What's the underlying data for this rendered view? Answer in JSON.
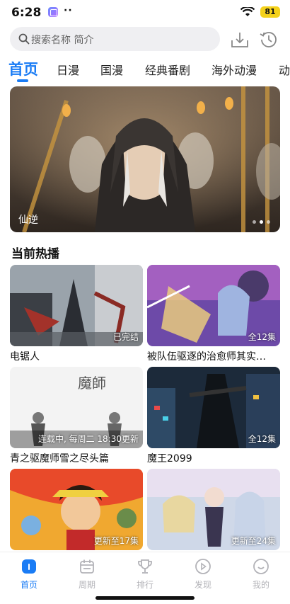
{
  "status": {
    "time": "6:28",
    "dots": "··",
    "battery": "81"
  },
  "search": {
    "placeholder": "搜索名称 简介"
  },
  "tabs": [
    "首页",
    "日漫",
    "国漫",
    "经典番剧",
    "海外动漫",
    "动"
  ],
  "banner": {
    "title": "仙逆"
  },
  "section": {
    "title": "当前热播"
  },
  "cards": [
    {
      "title": "电锯人",
      "badge": "已完结"
    },
    {
      "title": "被队伍驱逐的治愈师其实…",
      "badge": "全12集"
    },
    {
      "title": "青之驱魔师雪之尽头篇",
      "badge": "连载中, 每周二 18:30更新"
    },
    {
      "title": "魔王2099",
      "badge": "全12集"
    },
    {
      "title": "",
      "badge": "更新至17集"
    },
    {
      "title": "",
      "badge": "更新至24集"
    }
  ],
  "nav": [
    {
      "label": "首页",
      "icon": "home-icon"
    },
    {
      "label": "周期",
      "icon": "calendar-icon"
    },
    {
      "label": "排行",
      "icon": "trophy-icon"
    },
    {
      "label": "发现",
      "icon": "play-circle-icon"
    },
    {
      "label": "我的",
      "icon": "smile-icon"
    }
  ],
  "colors": {
    "accent": "#1a7cf5",
    "battery": "#f4d11a",
    "nav_inactive": "#b3b3b8"
  }
}
